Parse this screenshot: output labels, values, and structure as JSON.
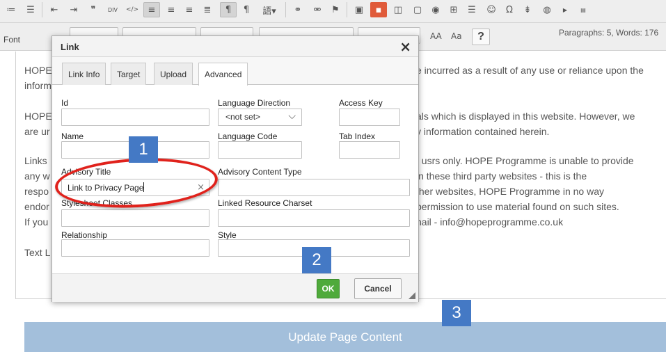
{
  "toolbar": {
    "font_label": "Font",
    "stats": "Paragraphs: 5, Words: 176",
    "help_label": "?",
    "icons": [
      "numbered-list-icon",
      "bulleted-list-icon",
      "outdent-icon",
      "indent-icon",
      "blockquote-icon",
      "div-icon",
      "code-icon",
      "align-left-icon",
      "align-center-icon",
      "align-right-icon",
      "justify-icon",
      "ltr-icon",
      "rtl-icon",
      "language-icon",
      "link-icon",
      "unlink-icon",
      "anchor-icon",
      "image-icon",
      "flash-icon",
      "iframe-icon",
      "video-icon",
      "audio-icon",
      "table-icon",
      "horizontal-rule-icon",
      "smiley-icon",
      "omega-icon",
      "pagebreak-icon",
      "globe-icon",
      "youtube-icon",
      "html-icon"
    ]
  },
  "editor": {
    "lines": [
      {
        "left": "HOPE",
        "right": "e incurred as a result of any use or reliance upon the"
      },
      {
        "left": "inform",
        "right": ""
      },
      {
        "left": "HOPE",
        "right": "als which is displayed in this website. However, we"
      },
      {
        "left": "are ur",
        "right": "y information contained herein."
      },
      {
        "left": "Links",
        "right": "f usrs only. HOPE Programme is unable to provide"
      },
      {
        "left": "any w",
        "right": "in these third party websites - this is the"
      },
      {
        "left": "respo",
        "right": "ther websites, HOPE Programme in no way"
      },
      {
        "left": "endor",
        "right": "permission to use material found on such sites."
      },
      {
        "left": "If you",
        "right": "nail - info@hopeprogramme.co.uk"
      },
      {
        "left": "Text L",
        "right": ""
      }
    ]
  },
  "dialog": {
    "title": "Link",
    "tabs": [
      {
        "label": "Link Info"
      },
      {
        "label": "Target"
      },
      {
        "label": "Upload"
      },
      {
        "label": "Advanced"
      }
    ],
    "active_tab": "Advanced",
    "fields": {
      "id_label": "Id",
      "lang_dir_label": "Language Direction",
      "lang_dir_value": "<not set>",
      "access_key_label": "Access Key",
      "name_label": "Name",
      "lang_code_label": "Language Code",
      "tab_index_label": "Tab Index",
      "advisory_title_label": "Advisory Title",
      "advisory_title_value": "Link to Privacy Page",
      "advisory_content_type_label": "Advisory Content Type",
      "stylesheet_classes_label": "Stylesheet Classes",
      "linked_charset_label": "Linked Resource Charset",
      "relationship_label": "Relationship",
      "style_label": "Style"
    },
    "ok_label": "OK",
    "cancel_label": "Cancel"
  },
  "callouts": {
    "one": "1",
    "two": "2",
    "three": "3",
    "color": "#4479c5"
  },
  "update_button": "Update Page Content",
  "colors": {
    "ok_green": "#4faa3b",
    "update_bar": "#a3bfdb",
    "highlight_red": "#e0221c"
  }
}
